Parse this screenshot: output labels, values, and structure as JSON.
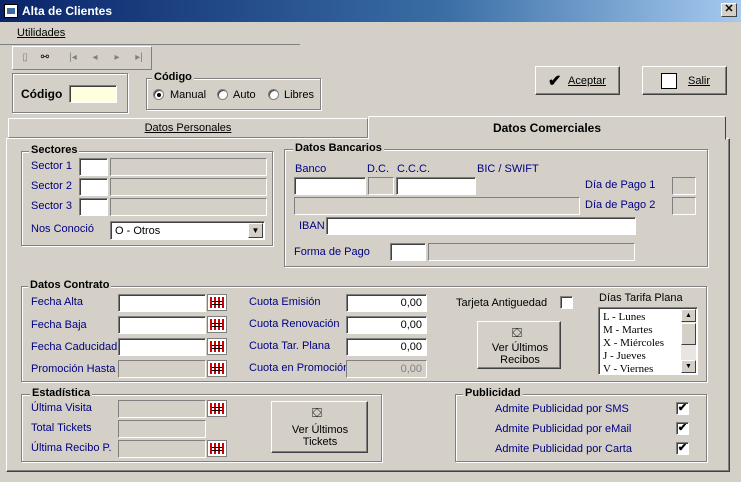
{
  "window": {
    "title": "Alta de Clientes",
    "close": "✕"
  },
  "menu": {
    "utilidades": "Utilidades"
  },
  "toolbar": {
    "icons": [
      "new-doc-icon",
      "find-icon",
      "first-icon",
      "prev-icon",
      "next-icon",
      "last-icon"
    ],
    "glyphs": [
      "▯",
      "⚯",
      "|◂",
      "◂",
      "▸",
      "▸|"
    ]
  },
  "codigo": {
    "label": "Código",
    "value": "",
    "group_title": "Código",
    "options": [
      "Manual",
      "Auto",
      "Libres"
    ],
    "selected": "Manual"
  },
  "buttons": {
    "aceptar": "Aceptar",
    "salir": "Salir",
    "ver_recibos": "Ver Últimos Recibos",
    "ver_tickets": "Ver Últimos Tickets"
  },
  "tabs": {
    "personales": "Datos Personales",
    "comerciales": "Datos Comerciales",
    "active": "comerciales"
  },
  "sectores": {
    "title": "Sectores",
    "rows": [
      {
        "label": "Sector 1",
        "code": "",
        "desc": ""
      },
      {
        "label": "Sector 2",
        "code": "",
        "desc": ""
      },
      {
        "label": "Sector 3",
        "code": "",
        "desc": ""
      }
    ],
    "nos_conocio_label": "Nos Conoció",
    "nos_conocio_value": "O - Otros"
  },
  "bancarios": {
    "title": "Datos Bancarios",
    "banco": "Banco",
    "dc": "D.C.",
    "ccc": "C.C.C.",
    "bic": "BIC / SWIFT",
    "dia_pago_1": "Día de Pago 1",
    "dia_pago_2": "Día de Pago 2",
    "iban": "IBAN",
    "forma_pago": "Forma de Pago"
  },
  "contrato": {
    "title": "Datos Contrato",
    "fecha_alta": "Fecha Alta",
    "fecha_baja": "Fecha Baja",
    "fecha_caducidad": "Fecha Caducidad",
    "promocion_hasta": "Promoción Hasta",
    "cuota_emision": "Cuota Emisión",
    "cuota_renovacion": "Cuota Renovación",
    "cuota_tar_plana": "Cuota Tar. Plana",
    "cuota_promocion": "Cuota en Promoción",
    "val_emision": "0,00",
    "val_renovacion": "0,00",
    "val_tar_plana": "0,00",
    "val_promocion": "0,00",
    "tarjeta_antiguedad": "Tarjeta Antiguedad",
    "dias_tarifa_plana": "Días Tarifa Plana",
    "dias": [
      "L - Lunes",
      "M - Martes",
      "X - Miércoles",
      "J - Jueves",
      "V - Viernes"
    ]
  },
  "estadistica": {
    "title": "Estadística",
    "ultima_visita": "Última Visita",
    "total_tickets": "Total Tickets",
    "ultimo_recibo": "Última Recibo P."
  },
  "publicidad": {
    "title": "Publicidad",
    "sms": "Admite Publicidad por SMS",
    "email": "Admite Publicidad por eMail",
    "carta": "Admite Publicidad por Carta",
    "sms_checked": "✔",
    "email_checked": "✔",
    "carta_checked": "✔"
  }
}
